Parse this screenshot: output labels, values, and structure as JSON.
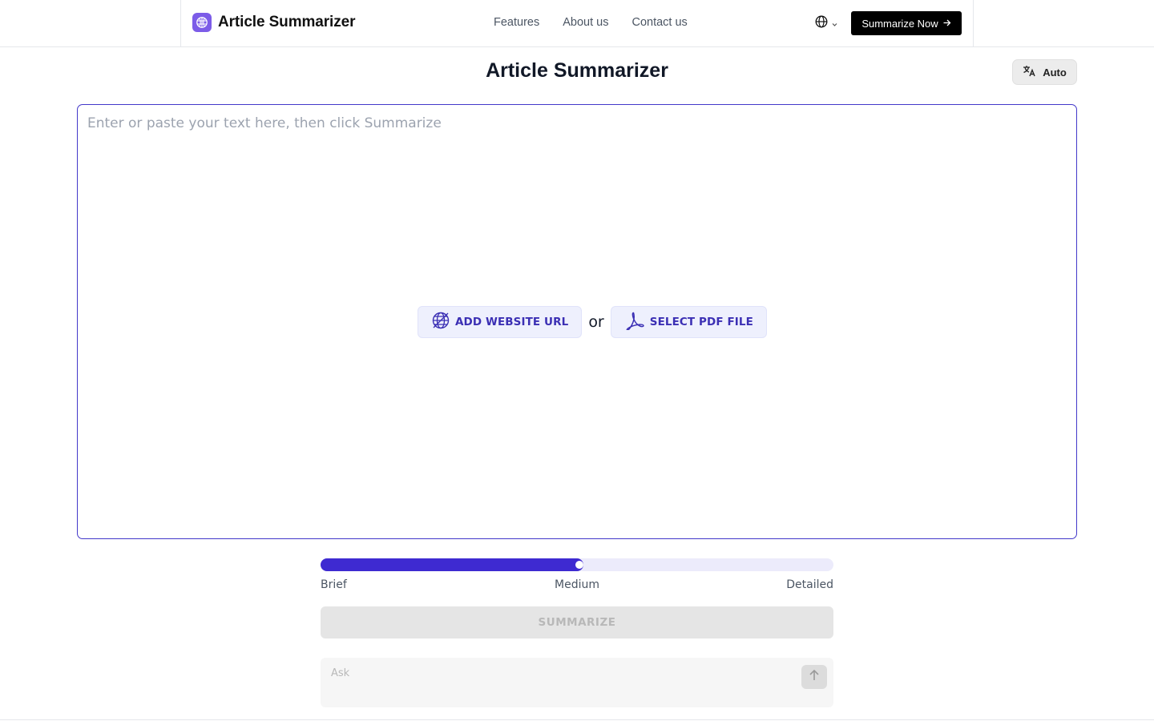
{
  "header": {
    "brand_name": "Article Summarizer",
    "nav": [
      {
        "label": "Features"
      },
      {
        "label": "About us"
      },
      {
        "label": "Contact us"
      }
    ],
    "language_icon": "globe-icon",
    "cta_label": "Summarize Now"
  },
  "main": {
    "title": "Article Summarizer",
    "output_language_label": "Auto",
    "editor_placeholder": "Enter or paste your text here, then click Summarize",
    "add_url_label": "ADD WEBSITE URL",
    "or_label": "or",
    "select_pdf_label": "SELECT PDF FILE"
  },
  "length_slider": {
    "value_fraction": 0.5,
    "labels": [
      "Brief",
      "Medium",
      "Detailed"
    ],
    "selected": "Medium"
  },
  "summarize_label": "SUMMARIZE",
  "ask": {
    "placeholder": "Ask"
  },
  "colors": {
    "accent": "#3e2ad1",
    "editor_border": "#4338ca",
    "logo_bg": "#7c5ce8",
    "source_button_bg": "#eef0fd",
    "disabled_button_bg": "#e5e5e5"
  }
}
